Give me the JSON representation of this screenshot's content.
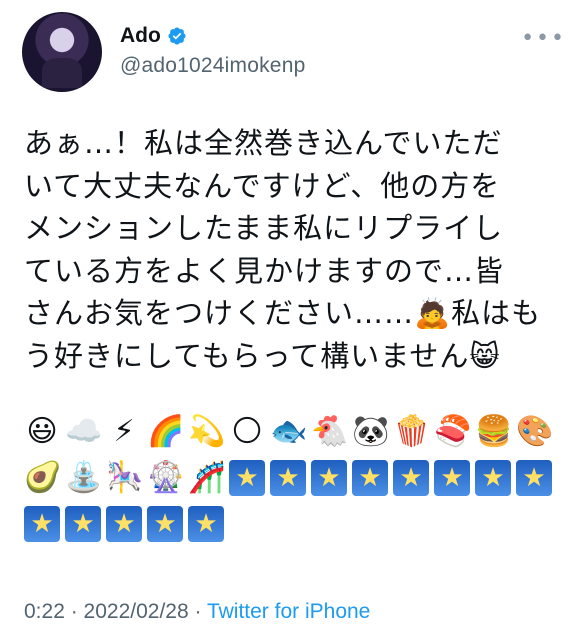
{
  "user": {
    "display_name": "Ado",
    "handle": "@ado1024imokenp",
    "verified": true
  },
  "more_icon": "more-horizontal-icon",
  "tweet": {
    "lines": [
      "あぁ…！私は全然巻き込んでいただ",
      "いて大丈夫なんですけど、他の方を",
      "メンションしたまま私にリプライし",
      "ている方をよく見かけますので…皆",
      "さんお気をつけください……🙇私はも",
      "う好きにしてもらって構いません😸"
    ],
    "emoji_rows": [
      [
        "😃",
        "☁️",
        "⚡",
        "🌈",
        "💫",
        "🌕",
        "🐟",
        "🐔",
        "🐼",
        "🍿",
        "🍣",
        "🍔",
        "🎨"
      ],
      [
        "🥑",
        "⛲",
        "🎠",
        "🎡",
        "🎢",
        "🌠",
        "🌠",
        "🌠",
        "🌠",
        "🌠",
        "🌠",
        "🌠",
        "🌠"
      ],
      [
        "🌠",
        "🌠",
        "🌠",
        "🌠",
        "🌠"
      ]
    ]
  },
  "meta": {
    "time": "0:22",
    "separator1": " · ",
    "date": "2022/02/28",
    "separator2": " · ",
    "source": "Twitter for iPhone"
  },
  "colors": {
    "text": "#0f1419",
    "secondary": "#536471",
    "link": "#1d9bf0",
    "verified": "#1d9bf0"
  }
}
